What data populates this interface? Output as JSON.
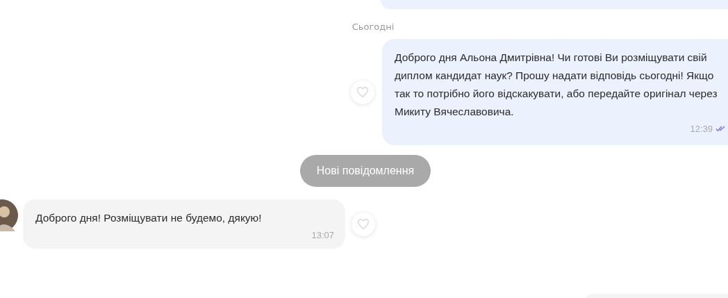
{
  "date_separator": "Сьогодні",
  "messages": [
    {
      "kind": "outgoing",
      "text": "Доброго дня Альона Дмитрівна! Чи готові Ви розміщувати свій диплом кандидат наук? Прошу надати відповідь сьогодні! Якщо так то потрібно його відскакувати, або передайте оригінал через Микиту Вячеславовича.",
      "time": "12:39"
    },
    {
      "kind": "new_divider",
      "text": "Нові повідомлення"
    },
    {
      "kind": "incoming",
      "text": "Доброго дня! Розміщувати не будемо, дякую!",
      "time": "13:07"
    }
  ]
}
